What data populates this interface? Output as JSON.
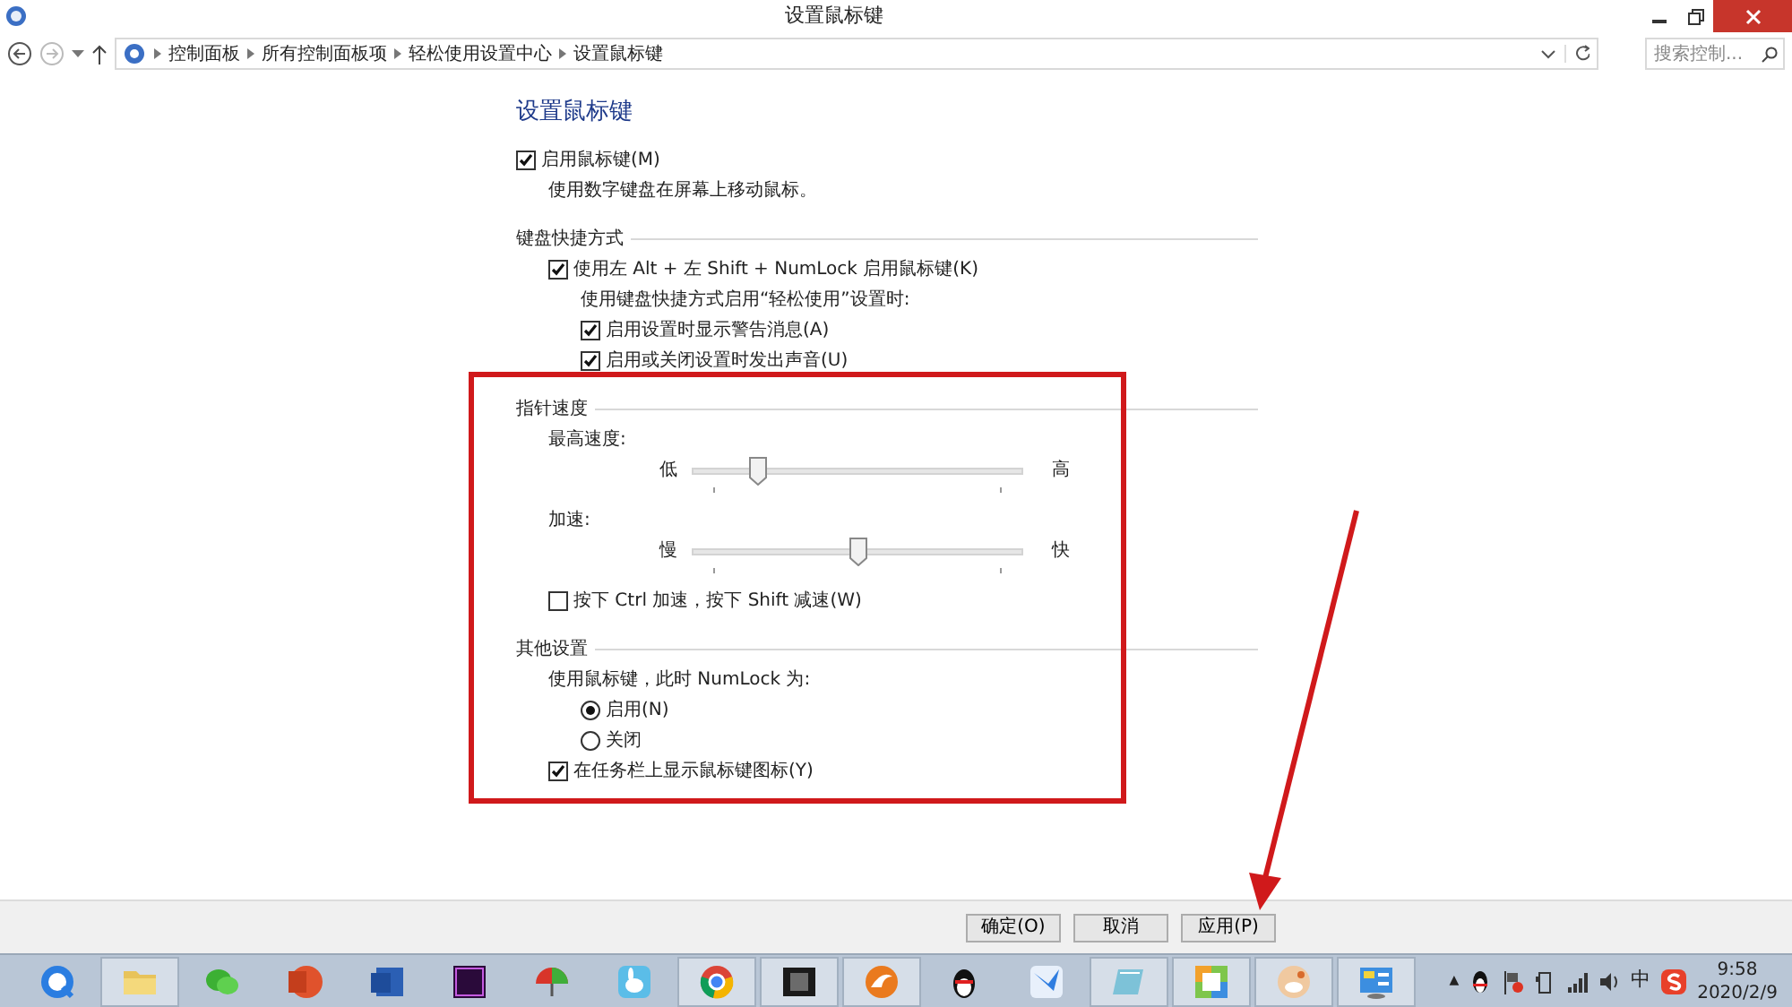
{
  "window": {
    "title": "设置鼠标键"
  },
  "address_bar": {
    "breadcrumbs": [
      "控制面板",
      "所有控制面板项",
      "轻松使用设置中心",
      "设置鼠标键"
    ],
    "search": {
      "placeholder": "搜索控制..."
    }
  },
  "page": {
    "heading": "设置鼠标键",
    "main": {
      "kind": "checkbox",
      "label": "启用鼠标键(M)",
      "checked": true,
      "children": [
        {
          "kind": "note",
          "text": "使用数字键盘在屏幕上移动鼠标。"
        }
      ]
    },
    "sections": [
      {
        "title": "键盘快捷方式",
        "items": [
          {
            "kind": "checkbox",
            "label": "使用左 Alt + 左 Shift + NumLock 启用鼠标键(K)",
            "checked": true,
            "children": [
              {
                "kind": "note",
                "text": "使用键盘快捷方式启用“轻松使用”设置时:"
              },
              {
                "kind": "checkbox",
                "label": "启用设置时显示警告消息(A)",
                "checked": true
              },
              {
                "kind": "checkbox",
                "label": "启用或关闭设置时发出声音(U)",
                "checked": true
              }
            ]
          }
        ]
      },
      {
        "title": "指针速度",
        "items": [
          {
            "kind": "note",
            "text": "最高速度:",
            "children": [
              {
                "kind": "slider",
                "low": "低",
                "high": "高",
                "level": 0.18
              }
            ]
          },
          {
            "kind": "note",
            "text": "加速:",
            "children": [
              {
                "kind": "slider",
                "low": "慢",
                "high": "快",
                "level": 0.5
              }
            ]
          },
          {
            "kind": "checkbox",
            "label": "按下 Ctrl 加速，按下 Shift 减速(W)",
            "checked": false
          }
        ]
      },
      {
        "title": "其他设置",
        "items": [
          {
            "kind": "note",
            "text": "使用鼠标键，此时 NumLock 为:",
            "children": [
              {
                "kind": "radio",
                "label": "启用(N)",
                "selected": true
              },
              {
                "kind": "radio",
                "label": "关闭",
                "selected": false
              }
            ]
          },
          {
            "kind": "checkbox",
            "label": "在任务栏上显示鼠标键图标(Y)",
            "checked": true
          }
        ]
      }
    ]
  },
  "buttons": [
    "确定(O)",
    "取消",
    "应用(P)"
  ],
  "taskbar": {
    "apps": [
      {
        "kind": "browser",
        "running": false
      },
      {
        "kind": "folder",
        "running": true
      },
      {
        "kind": "chat",
        "running": false
      },
      {
        "kind": "slides",
        "running": false
      },
      {
        "kind": "document",
        "running": false
      },
      {
        "kind": "video",
        "running": false
      },
      {
        "kind": "umbrella",
        "running": false
      },
      {
        "kind": "rabbit",
        "running": false
      },
      {
        "kind": "chrome",
        "running": true
      },
      {
        "kind": "film",
        "running": true
      },
      {
        "kind": "fox",
        "running": true
      },
      {
        "kind": "penguin",
        "running": false
      },
      {
        "kind": "bird",
        "running": false
      },
      {
        "kind": "notepad",
        "running": true
      },
      {
        "kind": "calendar",
        "running": true
      },
      {
        "kind": "photo",
        "running": true
      },
      {
        "kind": "panel",
        "running": true
      }
    ],
    "tray": {
      "overflow": "▲",
      "ime": "中",
      "time": "9:58",
      "date": "2020/2/9"
    }
  }
}
